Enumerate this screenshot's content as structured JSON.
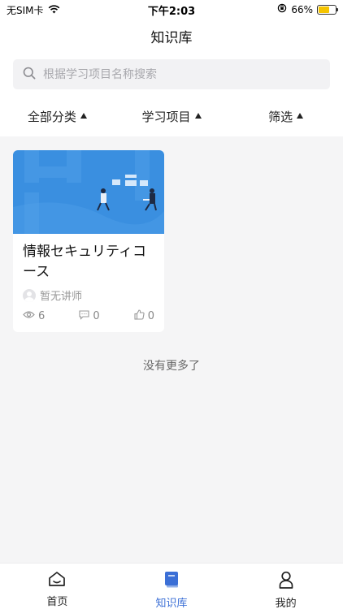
{
  "status_bar": {
    "carrier": "无SIM卡",
    "time": "下午2:03",
    "battery_percent": "66%",
    "battery_level": 0.66
  },
  "header": {
    "title": "知识库"
  },
  "search": {
    "placeholder": "根据学习项目名称搜索",
    "value": ""
  },
  "filters": [
    {
      "label": "全部分类"
    },
    {
      "label": "学习项目"
    },
    {
      "label": "筛选"
    }
  ],
  "courses": [
    {
      "title": "情報セキュリティコース",
      "author": "暂无讲师",
      "views": "6",
      "comments": "0",
      "likes": "0"
    }
  ],
  "list_end_text": "没有更多了",
  "tab_bar": {
    "items": [
      {
        "label": "首页",
        "icon": "home-icon"
      },
      {
        "label": "知识库",
        "icon": "book-icon",
        "active": true
      },
      {
        "label": "我的",
        "icon": "person-icon"
      }
    ]
  },
  "colors": {
    "accent": "#3b6fd6",
    "banner_blue": "#3a8fe0",
    "battery": "#f5c400"
  }
}
